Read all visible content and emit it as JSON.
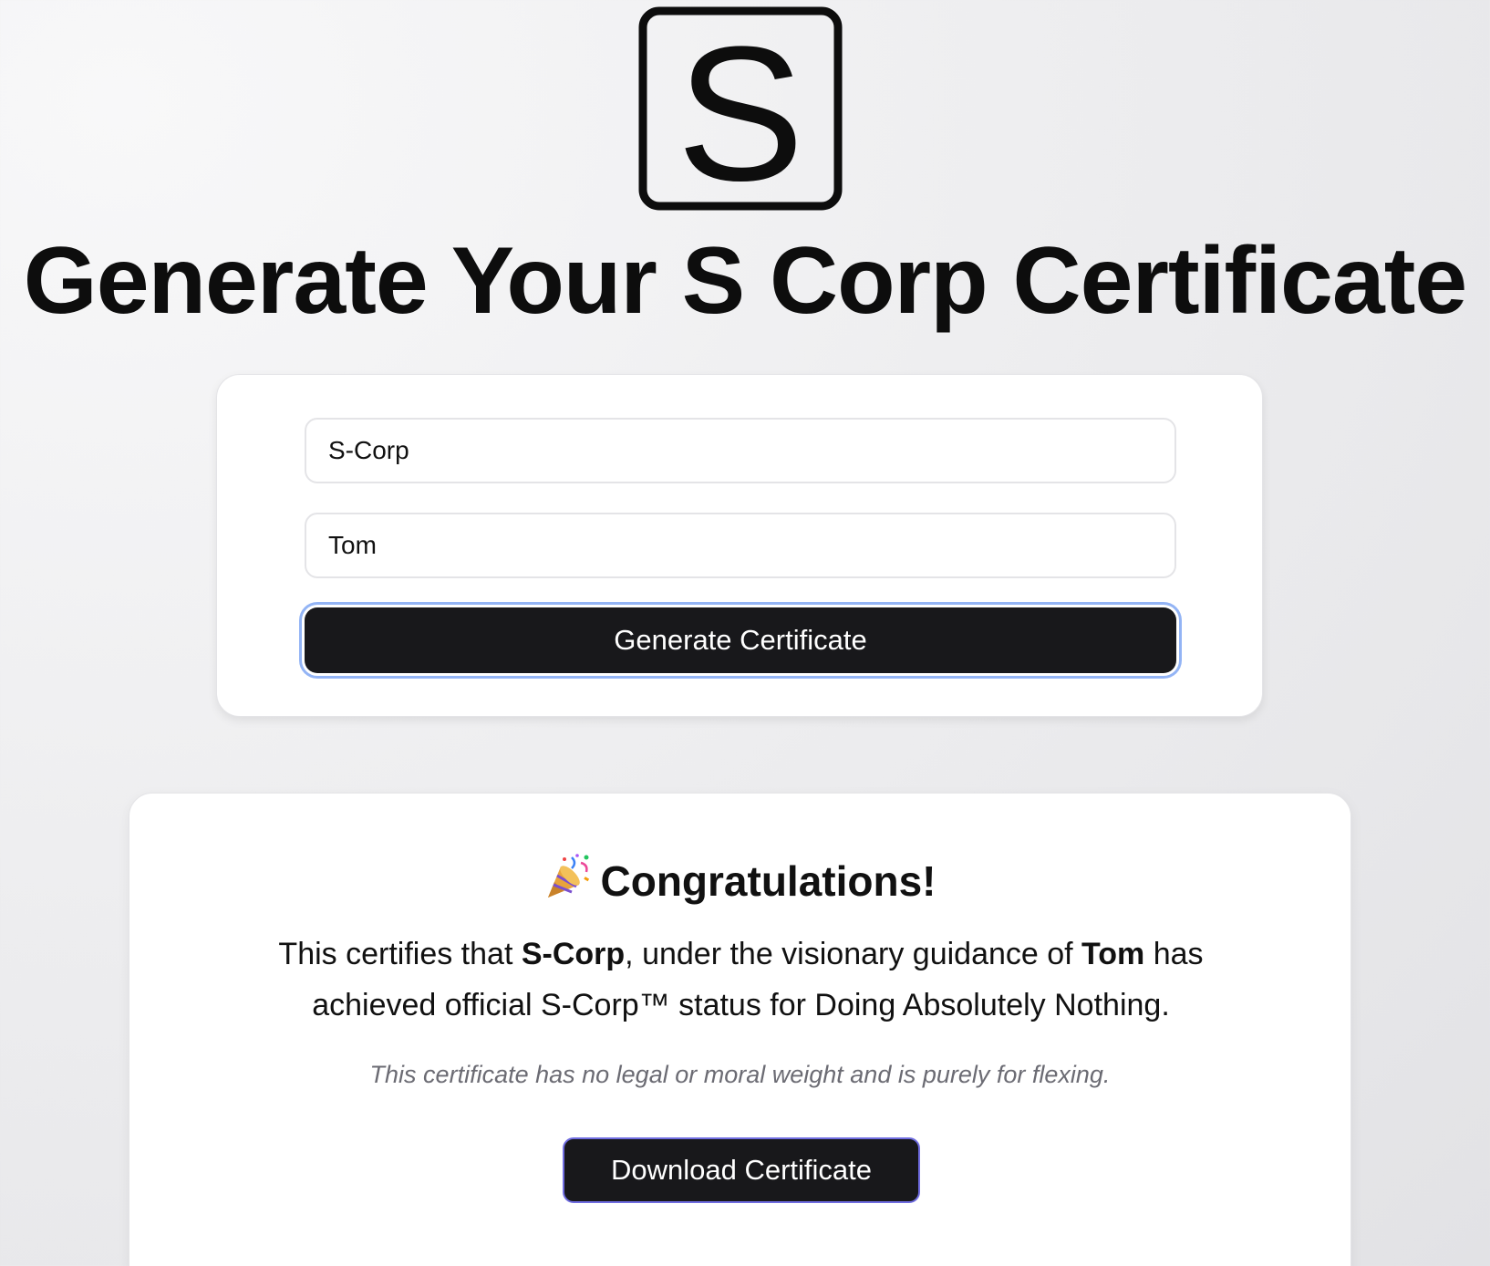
{
  "logo": {
    "letter": "S",
    "icon": "s-logo-icon"
  },
  "header": {
    "title": "Generate Your S Corp Certificate"
  },
  "form": {
    "company_value": "S-Corp",
    "owner_value": "Tom",
    "generate_label": "Generate Certificate"
  },
  "certificate": {
    "icon": "party-popper-icon",
    "heading": "Congratulations!",
    "text_before_company": "This certifies that ",
    "company": "S-Corp",
    "text_before_owner": ", under the visionary guidance of ",
    "owner": "Tom",
    "text_after_owner": " has achieved official S-Corp™ status for Doing Absolutely Nothing.",
    "disclaimer": "This certificate has no legal or moral weight and is purely for flexing.",
    "download_label": "Download Certificate"
  },
  "colors": {
    "button_bg": "#18181b",
    "focus_ring": "#93b4f5",
    "download_border": "#6f6ce0",
    "disclaimer_text": "#6b6b73"
  }
}
